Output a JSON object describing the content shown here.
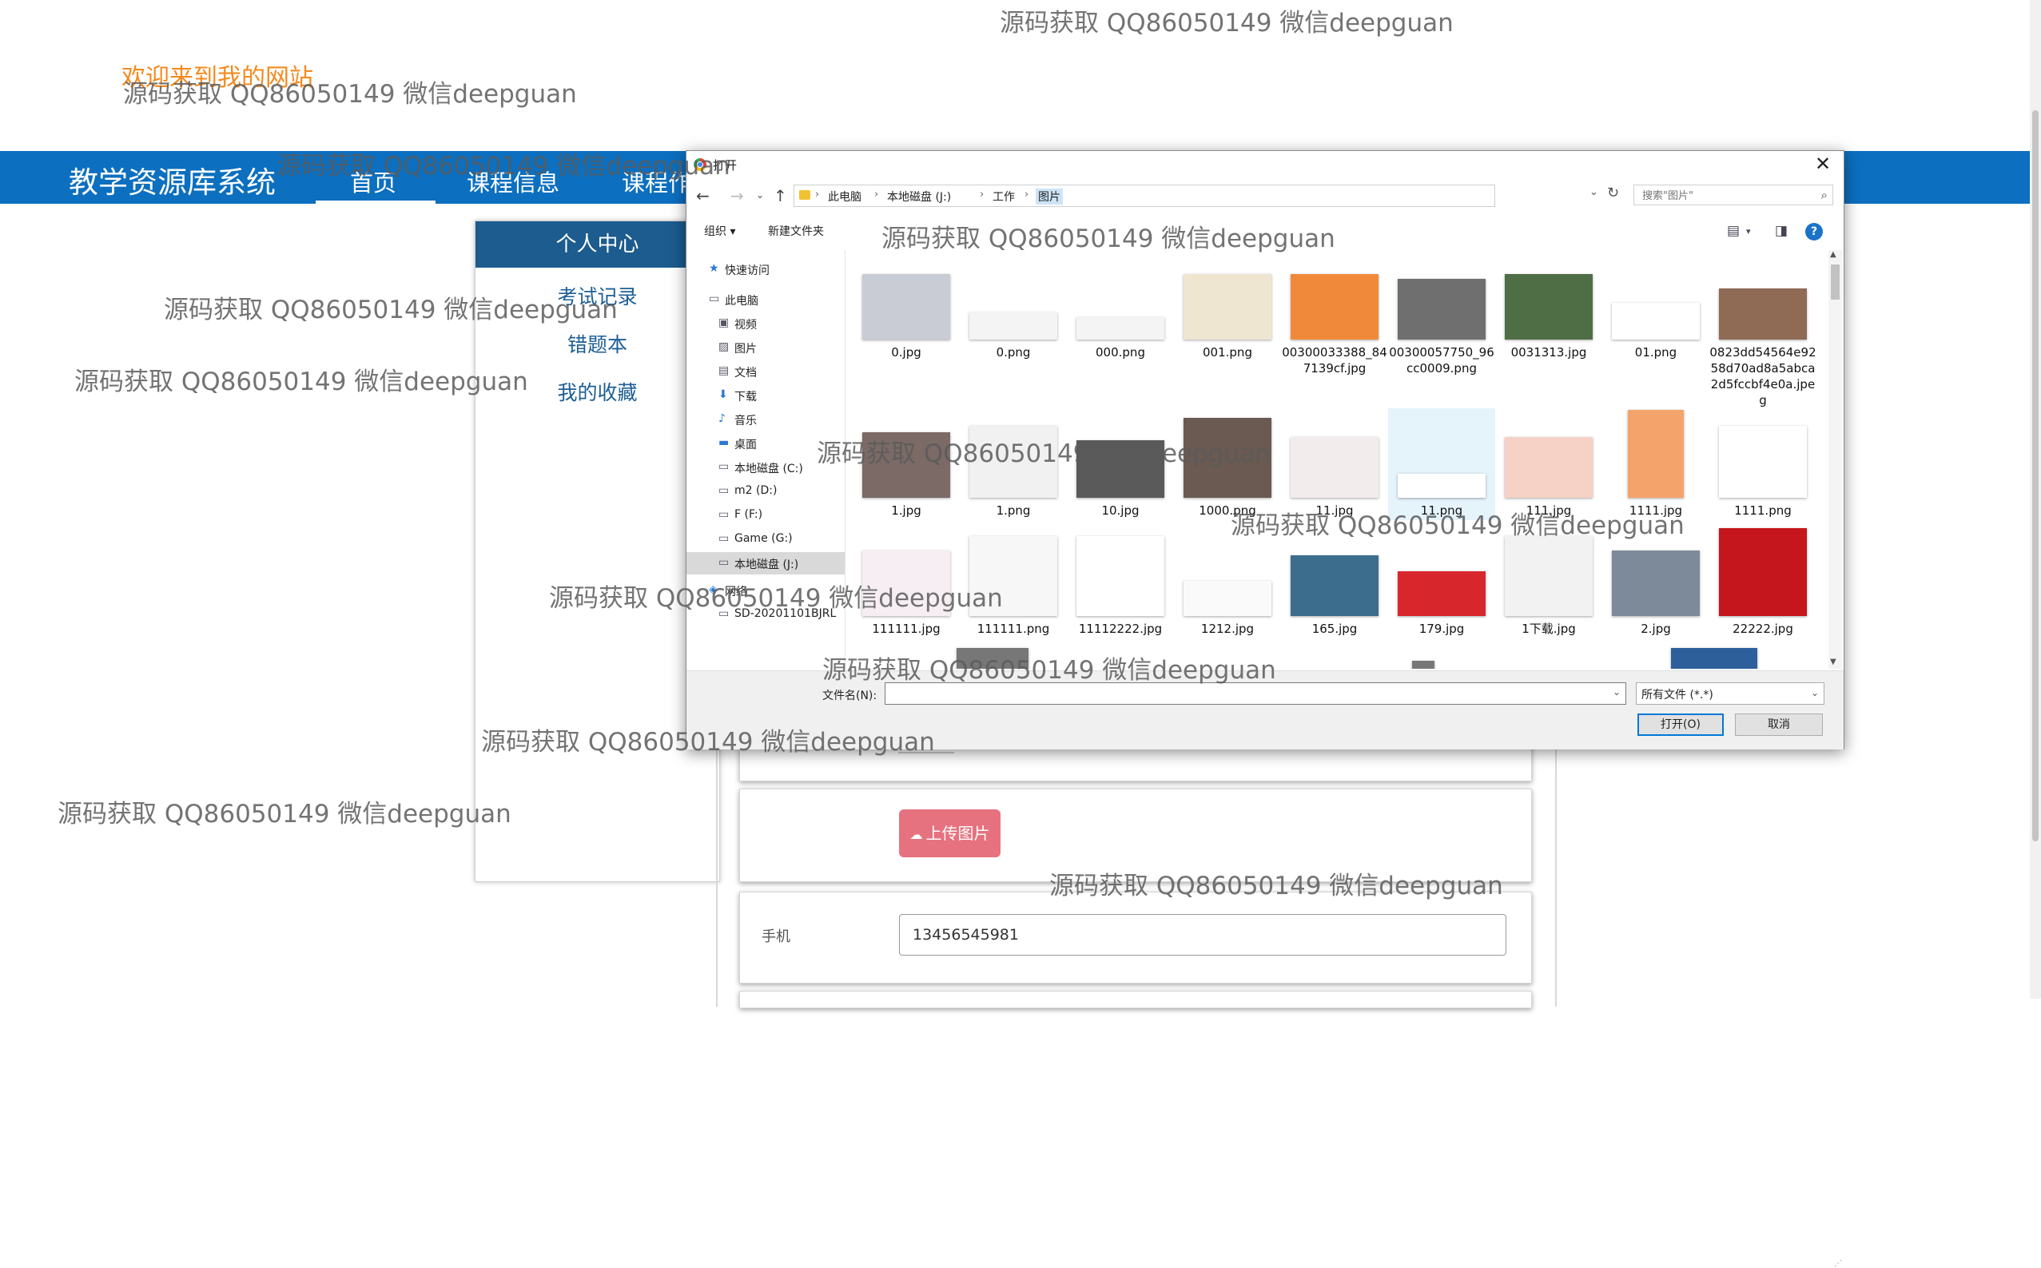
{
  "site": {
    "welcome": "欢迎来到我的网站",
    "brand": "教学资源库系统",
    "nav": [
      "首页",
      "课程信息",
      "课程作"
    ],
    "panel": {
      "title": "个人中心",
      "links": [
        "考试记录",
        "错题本",
        "我的收藏"
      ]
    },
    "upload_label": "上传图片",
    "phone_label": "手机",
    "phone_value": "13456545981"
  },
  "dialog": {
    "title": "打开",
    "breadcrumbs": [
      "此电脑",
      "本地磁盘 (J:)",
      "工作",
      "图片"
    ],
    "search_placeholder": "搜索\"图片\"",
    "toolbar": {
      "organize": "组织 ▾",
      "new_folder": "新建文件夹"
    },
    "nav_items": [
      {
        "label": "快速访问",
        "icon": "star-icon"
      },
      {
        "label": "此电脑",
        "icon": "computer-icon"
      },
      {
        "label": "视频",
        "icon": "video-icon"
      },
      {
        "label": "图片",
        "icon": "picture-icon"
      },
      {
        "label": "文档",
        "icon": "document-icon"
      },
      {
        "label": "下载",
        "icon": "download-icon"
      },
      {
        "label": "音乐",
        "icon": "music-icon"
      },
      {
        "label": "桌面",
        "icon": "desktop-icon"
      },
      {
        "label": "本地磁盘 (C:)",
        "icon": "drive-icon"
      },
      {
        "label": "m2 (D:)",
        "icon": "drive-icon"
      },
      {
        "label": "F (F:)",
        "icon": "drive-icon"
      },
      {
        "label": "Game (G:)",
        "icon": "drive-icon"
      },
      {
        "label": "本地磁盘 (J:)",
        "icon": "drive-icon"
      },
      {
        "label": "网络",
        "icon": "network-icon"
      },
      {
        "label": "SD-20201101BJRL",
        "icon": "computer-icon"
      }
    ],
    "files": [
      {
        "name": "0.jpg",
        "color": "#c9ccd4"
      },
      {
        "name": "0.png",
        "color": "#f4f4f4"
      },
      {
        "name": "000.png",
        "color": "#f4f4f4"
      },
      {
        "name": "001.png",
        "color": "#efe6d2"
      },
      {
        "name": "00300033388_847139cf.jpg",
        "color": "#f08a3a"
      },
      {
        "name": "00300057750_96cc0009.png",
        "color": "#6f6f6f"
      },
      {
        "name": "0031313.jpg",
        "color": "#4f6e45"
      },
      {
        "name": "01.png",
        "color": "#ffffff"
      },
      {
        "name": "0823dd54564e9258d70ad8a5abca2d5fccbf4e0a.jpeg",
        "color": "#8f6a55"
      },
      {
        "name": "1.jpg",
        "color": "#7b6a66"
      },
      {
        "name": "1.png",
        "color": "#f1f1f1"
      },
      {
        "name": "10.jpg",
        "color": "#5a5a5a"
      },
      {
        "name": "1000.png",
        "color": "#6b5a52"
      },
      {
        "name": "11.jpg",
        "color": "#f3ecec"
      },
      {
        "name": "11.png",
        "color": "#ffffff"
      },
      {
        "name": "111.jpg",
        "color": "#f5d1c6"
      },
      {
        "name": "1111.jpg",
        "color": "#f4a46b"
      },
      {
        "name": "1111.png",
        "color": "#ffffff"
      },
      {
        "name": "111111.jpg",
        "color": "#f6eef3"
      },
      {
        "name": "111111.png",
        "color": "#f7f7f7"
      },
      {
        "name": "11112222.jpg",
        "color": "#ffffff"
      },
      {
        "name": "1212.jpg",
        "color": "#fafafa"
      },
      {
        "name": "165.jpg",
        "color": "#3d6d8c"
      },
      {
        "name": "179.jpg",
        "color": "#d8262d"
      },
      {
        "name": "1下载.jpg",
        "color": "#f2f2f2"
      },
      {
        "name": "2.jpg",
        "color": "#7c8a9a"
      },
      {
        "name": "22222.jpg",
        "color": "#c4161c"
      }
    ],
    "filename_label": "文件名(N):",
    "filename_value": "",
    "filter_value": "所有文件 (*.*)",
    "open_label": "打开(O)",
    "cancel_label": "取消"
  },
  "watermark": "源码获取 QQ86050149 微信deepguan"
}
